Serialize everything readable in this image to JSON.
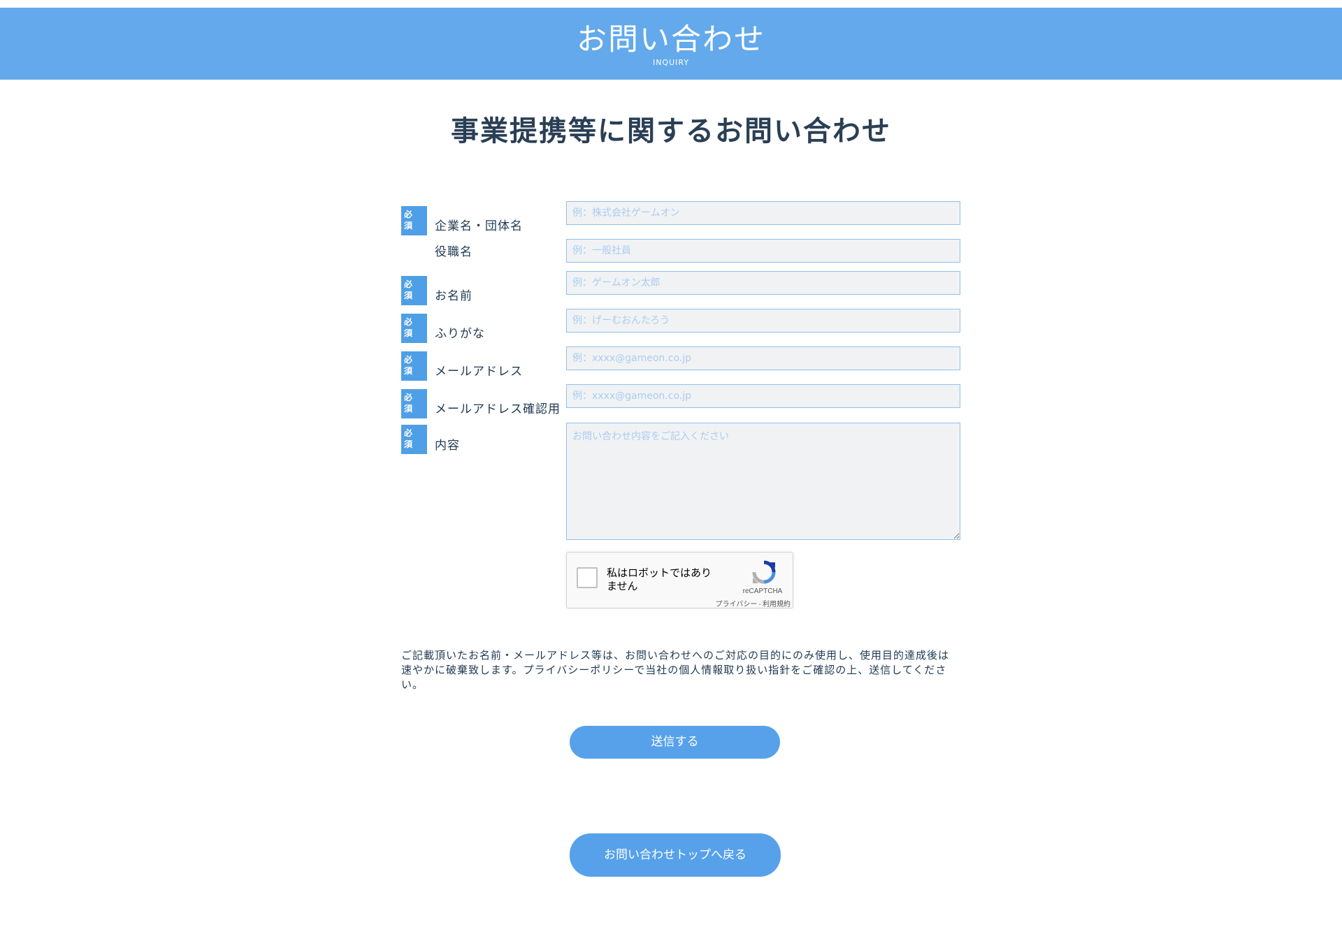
{
  "header": {
    "title": "お問い合わせ",
    "subtitle": "INQUIRY",
    "band_color": "#63a9ec"
  },
  "page_heading": "事業提携等に関するお問い合わせ",
  "required_badge": "必\n須",
  "form": {
    "fields": [
      {
        "label": "企業名・団体名",
        "placeholder": "例：株式会社ゲームオン",
        "required": true
      },
      {
        "label": "役職名",
        "placeholder": "例：一般社員",
        "required": false
      },
      {
        "label": "お名前",
        "placeholder": "例：ゲームオン太郎",
        "required": true
      },
      {
        "label": "ふりがな",
        "placeholder": "例：げーむおんたろう",
        "required": true
      },
      {
        "label": "メールアドレス",
        "placeholder": "例：xxxx@gameon.co.jp",
        "required": true
      },
      {
        "label": "メールアドレス確認用",
        "placeholder": "例：xxxx@gameon.co.jp",
        "required": true
      },
      {
        "label": "内容",
        "placeholder": "お問い合わせ内容をご記入ください",
        "required": true
      }
    ]
  },
  "recaptcha": {
    "label": "私はロボットではありません",
    "brand": "reCAPTCHA",
    "privacy_link": "プライバシー",
    "separator": "-",
    "terms_link": "利用規約"
  },
  "privacy_notice": "ご記載頂いたお名前・メールアドレス等は、お問い合わせへのご対応の目的にのみ使用し、使用目的達成後は速やかに破棄致します。プライバシーポリシーで当社の個人情報取り扱い指針をご確認の上、送信してください。",
  "buttons": {
    "submit": "送信する",
    "back": "お問い合わせトップへ戻る"
  },
  "colors": {
    "accent": "#57a1ea",
    "badge": "#4f9fe6",
    "input_bg": "#f1f2f4",
    "input_border": "#8ec1ef"
  }
}
